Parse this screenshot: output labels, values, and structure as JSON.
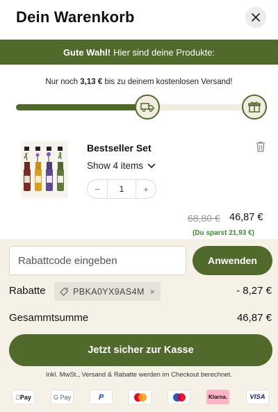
{
  "header": {
    "title": "Dein Warenkorb"
  },
  "banner": {
    "strong": "Gute Wahl!",
    "text": "Hier sind deine Produkte:"
  },
  "shipping": {
    "prefix": "Nur noch",
    "amount": "3,13 €",
    "suffix": "bis zu deinem kostenlosen Versand!",
    "progress": 0.55
  },
  "product": {
    "title": "Bestseller Set",
    "show_items": "Show 4 items",
    "quantity": "1",
    "price_old": "68,80 €",
    "price_new": "46,87 €",
    "savings": "(Du sparst 21,93 €)"
  },
  "coupon": {
    "placeholder": "Rabattcode eingeben",
    "button": "Anwenden"
  },
  "discount": {
    "label": "Rabatte",
    "code": "PBKA0YX9AS4M",
    "value": "- 8,27 €"
  },
  "total": {
    "label": "Gesammtsumme",
    "value": "46,87 €"
  },
  "checkout": {
    "button": "Jetzt sicher zur Kasse",
    "note": "inkl. MwSt., Versand & Rabatte werden im Checkout berechnet."
  },
  "payments": [
    {
      "name": "apple-pay",
      "label": "Pay"
    },
    {
      "name": "google-pay",
      "label": "G Pay"
    },
    {
      "name": "paypal",
      "label": "P"
    },
    {
      "name": "mastercard",
      "label": ""
    },
    {
      "name": "maestro",
      "label": ""
    },
    {
      "name": "klarna",
      "label": "Klarna."
    },
    {
      "name": "visa",
      "label": "VISA"
    }
  ],
  "colors": {
    "accent": "#4f6a2a",
    "cream": "#f6f1e7",
    "savings": "#3d8a2e"
  }
}
